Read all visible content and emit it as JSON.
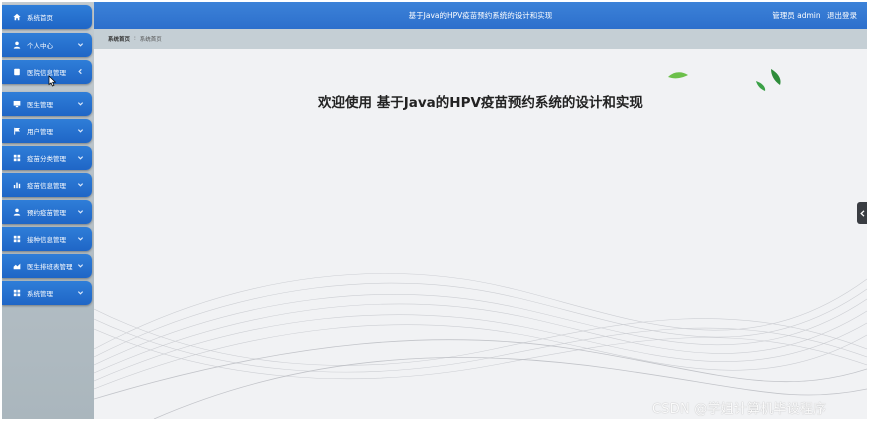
{
  "header": {
    "title": "基于Java的HPV疫苗预约系统的设计和实现",
    "user_label": "管理员 admin",
    "logout_label": "退出登录"
  },
  "breadcrumb": {
    "home": "系统首页",
    "current": "系统首页"
  },
  "sidebar": {
    "items": [
      {
        "label": "系统首页",
        "icon": "home-icon"
      },
      {
        "label": "个人中心",
        "icon": "user-icon"
      },
      {
        "label": "医院信息管理",
        "icon": "hospital-icon"
      },
      {
        "label": "医生管理",
        "icon": "monitor-icon"
      },
      {
        "label": "用户管理",
        "icon": "flag-icon"
      },
      {
        "label": "疫苗分类管理",
        "icon": "grid-icon"
      },
      {
        "label": "疫苗信息管理",
        "icon": "bar-chart-icon"
      },
      {
        "label": "预约疫苗管理",
        "icon": "user-icon"
      },
      {
        "label": "接种信息管理",
        "icon": "grid-icon"
      },
      {
        "label": "医生排班表管理",
        "icon": "area-chart-icon"
      },
      {
        "label": "系统管理",
        "icon": "grid-icon"
      }
    ]
  },
  "main": {
    "welcome": "欢迎使用 基于Java的HPV疫苗预约系统的设计和实现"
  },
  "watermark": "CSDN @学姐计算机毕设程序",
  "colors": {
    "primary": "#2f7ed8",
    "header": "#3c82d8",
    "sidebar_bg": "#b8c2c8",
    "breadcrumb_bg": "#c5cfd5",
    "main_bg": "#f1f2f4"
  }
}
